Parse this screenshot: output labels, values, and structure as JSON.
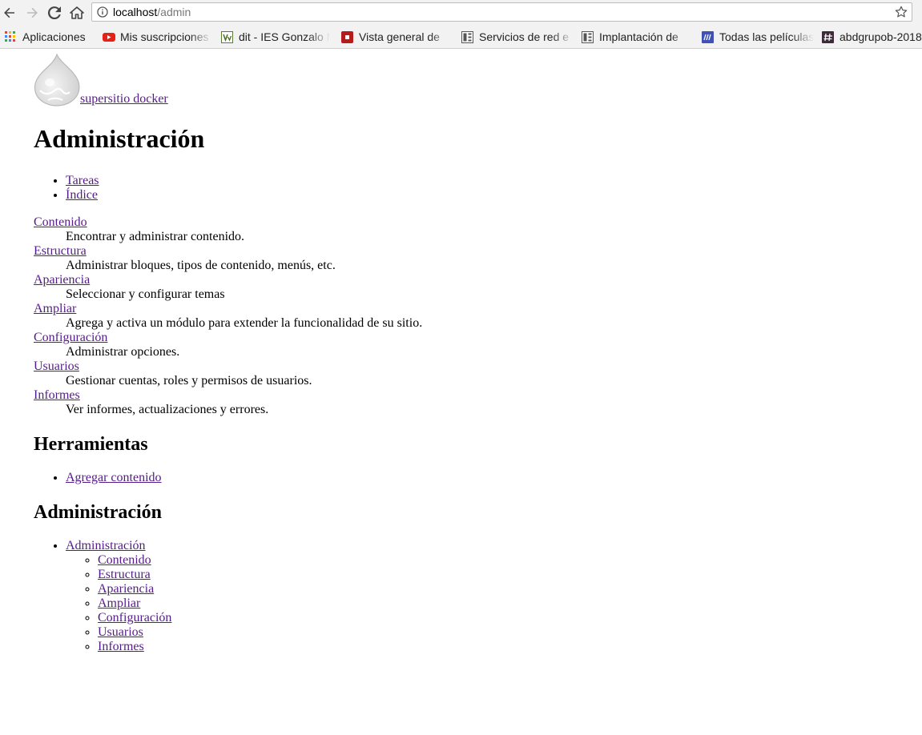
{
  "browser": {
    "url_host": "localhost",
    "url_path": "/admin",
    "bookmarks": [
      {
        "label": "Aplicaciones",
        "icon": "apps-grid-icon"
      },
      {
        "label": "Mis suscripciones",
        "icon": "youtube-icon"
      },
      {
        "label": "dit - IES Gonzalo Nazareno",
        "icon": "dit-favicon-icon"
      },
      {
        "label": "Vista general de",
        "icon": "red-square-favicon-icon"
      },
      {
        "label": "Servicios de red e",
        "icon": "building-favicon-icon"
      },
      {
        "label": "Implantación de",
        "icon": "building-favicon-icon"
      },
      {
        "label": "Todas las películas",
        "icon": "blue-favicon-icon"
      },
      {
        "label": "abdgrupob-2018",
        "icon": "hash-favicon-icon"
      }
    ]
  },
  "site": {
    "name": " supersitio docker",
    "page_title": "Administración",
    "tabs": [
      "Tareas",
      "Índice"
    ],
    "admin_sections": [
      {
        "title": "Contenido",
        "description": "Encontrar y administrar contenido."
      },
      {
        "title": "Estructura",
        "description": "Administrar bloques, tipos de contenido, menús, etc."
      },
      {
        "title": "Apariencia",
        "description": "Seleccionar y configurar temas"
      },
      {
        "title": "Ampliar",
        "description": "Agrega y activa un módulo para extender la funcionalidad de su sitio."
      },
      {
        "title": "Configuración",
        "description": "Administrar opciones."
      },
      {
        "title": "Usuarios",
        "description": "Gestionar cuentas, roles y permisos de usuarios."
      },
      {
        "title": "Informes",
        "description": "Ver informes, actualizaciones y errores."
      }
    ],
    "tools_heading": "Herramientas",
    "tools": [
      "Agregar contenido"
    ],
    "admin_menu_heading": "Administración",
    "admin_menu_root": "Administración",
    "admin_menu_items": [
      "Contenido",
      "Estructura",
      "Apariencia",
      "Ampliar",
      "Configuración",
      "Usuarios",
      "Informes"
    ]
  }
}
